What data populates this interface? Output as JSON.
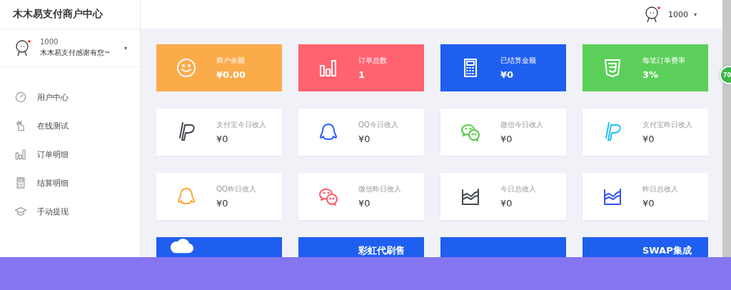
{
  "brand": "木木易支付商户中心",
  "user": {
    "id": "1000",
    "motto": "木木易支付感谢有您~",
    "caret": "▾"
  },
  "menu": [
    {
      "label": "用户中心",
      "kind": "gauge"
    },
    {
      "label": "在线测试",
      "kind": "hand"
    },
    {
      "label": "订单明细",
      "kind": "bars"
    },
    {
      "label": "结算明细",
      "kind": "calculator"
    },
    {
      "label": "手动提现",
      "kind": "cap"
    }
  ],
  "header": {
    "user": "1000",
    "caret": "▾"
  },
  "stats": [
    {
      "label": "商户余额",
      "value": "¥0.00",
      "kind": "smile",
      "color": "#fbab4a"
    },
    {
      "label": "订单总数",
      "value": "1",
      "kind": "bars",
      "color": "#ff636f"
    },
    {
      "label": "已结算金额",
      "value": "¥0",
      "kind": "calculator",
      "color": "#1f5ff0"
    },
    {
      "label": "每笔订单费率",
      "value": "3%",
      "kind": "shield",
      "color": "#5ccf5b"
    }
  ],
  "income": [
    {
      "label": "支付宝今日收入",
      "value": "¥0",
      "kind": "paypal",
      "color": "#444950"
    },
    {
      "label": "QQ今日收入",
      "value": "¥0",
      "kind": "qq",
      "color": "#2e5bff"
    },
    {
      "label": "微信今日收入",
      "value": "¥0",
      "kind": "wechat",
      "color": "#55c94a"
    },
    {
      "label": "支付宝昨日收入",
      "value": "¥0",
      "kind": "paypal",
      "color": "#1fc2f0"
    },
    {
      "label": "QQ昨日收入",
      "value": "¥0",
      "kind": "qq",
      "color": "#ffa43a"
    },
    {
      "label": "微信昨日收入",
      "value": "¥0",
      "kind": "wechat",
      "color": "#ff5a64"
    },
    {
      "label": "今日总收入",
      "value": "¥0",
      "kind": "area",
      "color": "#444950"
    },
    {
      "label": "昨日总收入",
      "value": "¥0",
      "kind": "area",
      "color": "#3552f0"
    }
  ],
  "promos": [
    {
      "kind": "cloud"
    },
    {
      "title": "彩虹代刷售"
    },
    {
      "kind": "blank"
    },
    {
      "title": "SWAP集成"
    }
  ],
  "badge": "70"
}
